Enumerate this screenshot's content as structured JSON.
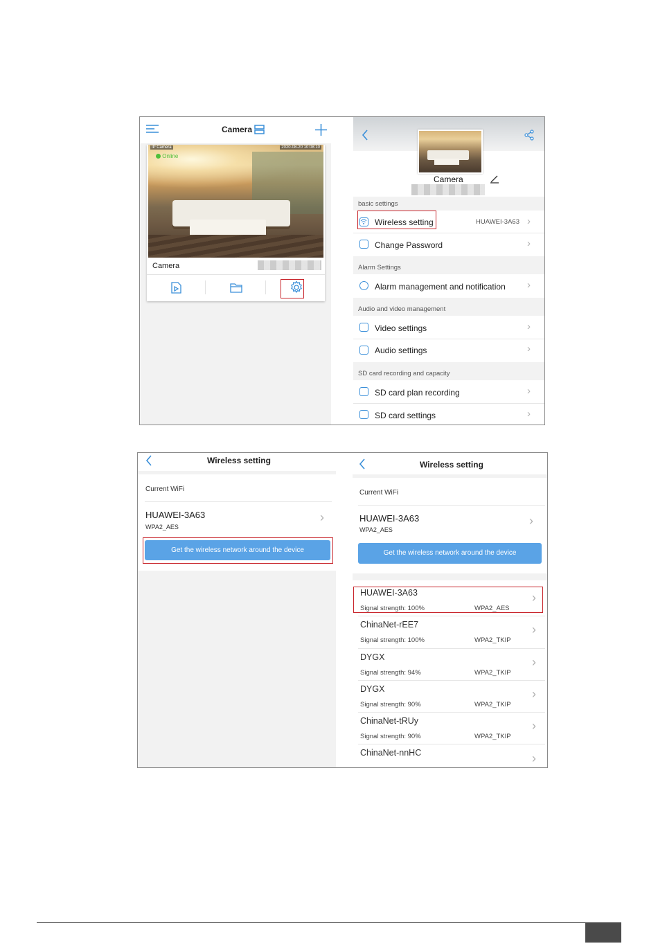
{
  "screen1": {
    "header_title": "Camera",
    "camera_card": {
      "status": "Online",
      "name": "Camera",
      "overlay_left": "IP Camera",
      "overlay_right": "2020-08-20 10:08:10"
    }
  },
  "screen2": {
    "device_name": "Camera",
    "sections": {
      "basic": "basic settings",
      "alarm": "Alarm Settings",
      "av": "Audio and video management",
      "sd": "SD card recording and capacity"
    },
    "items": {
      "wireless": "Wireless setting",
      "wireless_value": "HUAWEI-3A63",
      "password": "Change Password",
      "alarm": "Alarm management and notification",
      "video": "Video settings",
      "audio": "Audio settings",
      "sd_plan": "SD card plan recording",
      "sd_settings": "SD card settings"
    }
  },
  "screen3": {
    "title": "Wireless setting",
    "current_wifi_label": "Current WiFi",
    "current_ssid": "HUAWEI-3A63",
    "current_security": "WPA2_AES",
    "button": "Get the wireless network around the device"
  },
  "screen4": {
    "title": "Wireless setting",
    "current_wifi_label": "Current WiFi",
    "current_ssid": "HUAWEI-3A63",
    "current_security": "WPA2_AES",
    "button": "Get the wireless network around the device",
    "networks": [
      {
        "ssid": "HUAWEI-3A63",
        "signal": "Signal strength: 100%",
        "security": "WPA2_AES"
      },
      {
        "ssid": "ChinaNet-rEE7",
        "signal": "Signal strength: 100%",
        "security": "WPA2_TKIP"
      },
      {
        "ssid": "DYGX",
        "signal": "Signal strength: 94%",
        "security": "WPA2_TKIP"
      },
      {
        "ssid": "DYGX",
        "signal": "Signal strength: 90%",
        "security": "WPA2_TKIP"
      },
      {
        "ssid": "ChinaNet-tRUy",
        "signal": "Signal strength: 90%",
        "security": "WPA2_TKIP"
      },
      {
        "ssid": "ChinaNet-nnHC",
        "signal": "",
        "security": ""
      }
    ]
  }
}
